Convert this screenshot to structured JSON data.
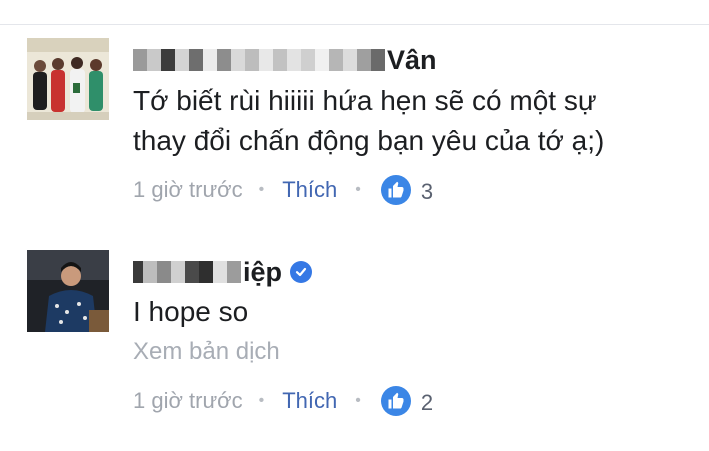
{
  "comments": [
    {
      "name_visible": "Vân",
      "text_lines": [
        "Tớ biết rùi hiiiii hứa hẹn sẽ có một sự",
        "thay đổi chấn động bạn yêu của tớ ạ;)"
      ],
      "time": "1 giờ trước",
      "like_label": "Thích",
      "reactions": "3",
      "verified": false
    },
    {
      "name_visible": "iệp",
      "text_lines": [
        "I hope so"
      ],
      "translate_label": "Xem bản dịch",
      "time": "1 giờ trước",
      "like_label": "Thích",
      "reactions": "2",
      "verified": true
    }
  ],
  "colors": {
    "like_link": "#4267b2",
    "reaction_badge": "#3b86e6",
    "verified_badge": "#3578e5",
    "meta_text": "#a0a5ad"
  },
  "icons": [
    "thumbs-up-icon",
    "verified-check-icon"
  ]
}
